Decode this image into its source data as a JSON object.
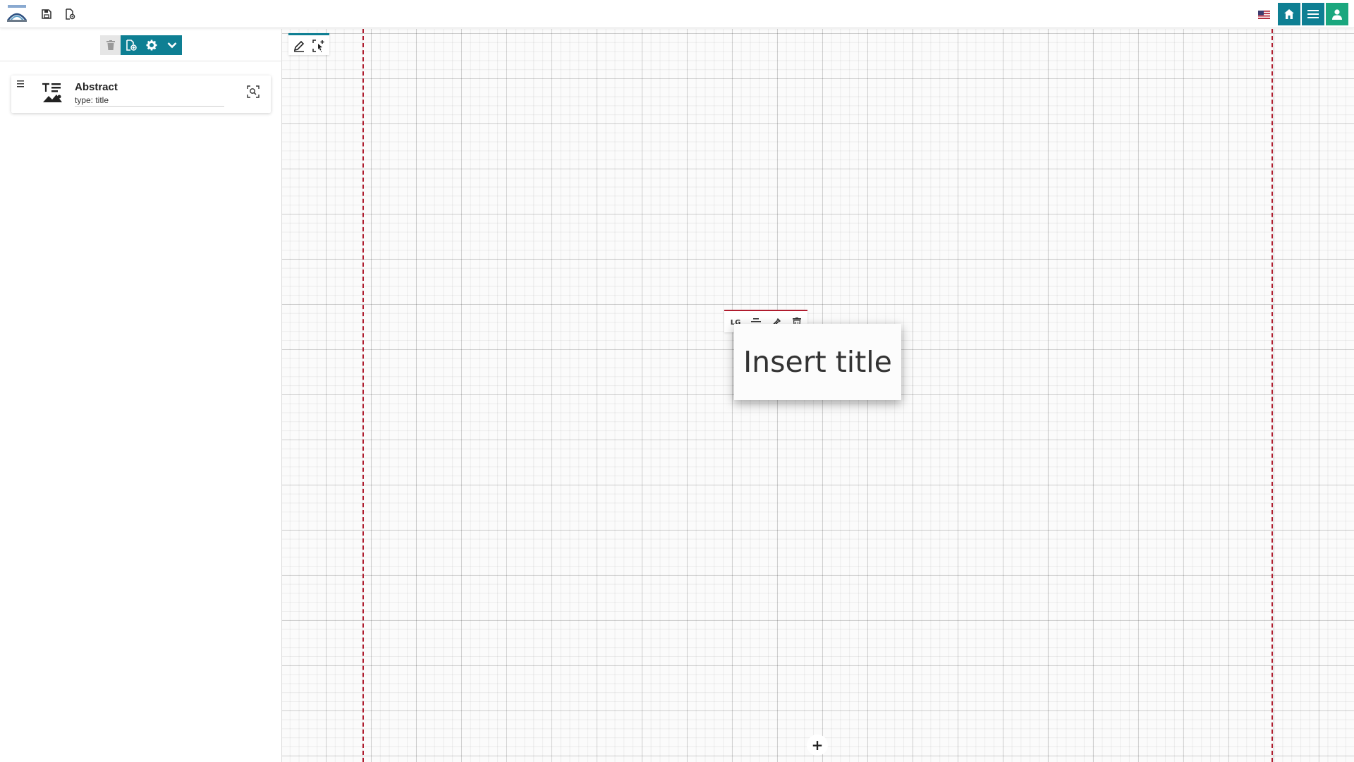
{
  "topbar": {
    "logo_name": "app-logo",
    "save_icon": "save-icon",
    "document_settings_icon": "document-gear-icon",
    "language_icon": "us-flag-icon",
    "home_icon": "home-icon",
    "menu_icon": "menu-icon",
    "user_icon": "user-icon",
    "colors": {
      "teal": "#0e7f93",
      "green": "#1aa77e"
    }
  },
  "left_panel": {
    "toolbar": {
      "buttons": [
        "trash-icon",
        "add-document-icon",
        "gear-icon",
        "chevron-down-icon"
      ]
    },
    "items": [
      {
        "title": "Abstract",
        "subtitle": "type: title",
        "icon": "title-image-icon"
      }
    ]
  },
  "canvas": {
    "tools": [
      "pencil-icon",
      "select-area-icon"
    ],
    "widget_toolbar": {
      "size_label": "LG",
      "buttons": [
        "align-center-icon",
        "eyedropper-icon",
        "trash-icon"
      ]
    },
    "title_placeholder": "Insert title",
    "add_button": "+",
    "margin_color": "#b01c2e"
  }
}
